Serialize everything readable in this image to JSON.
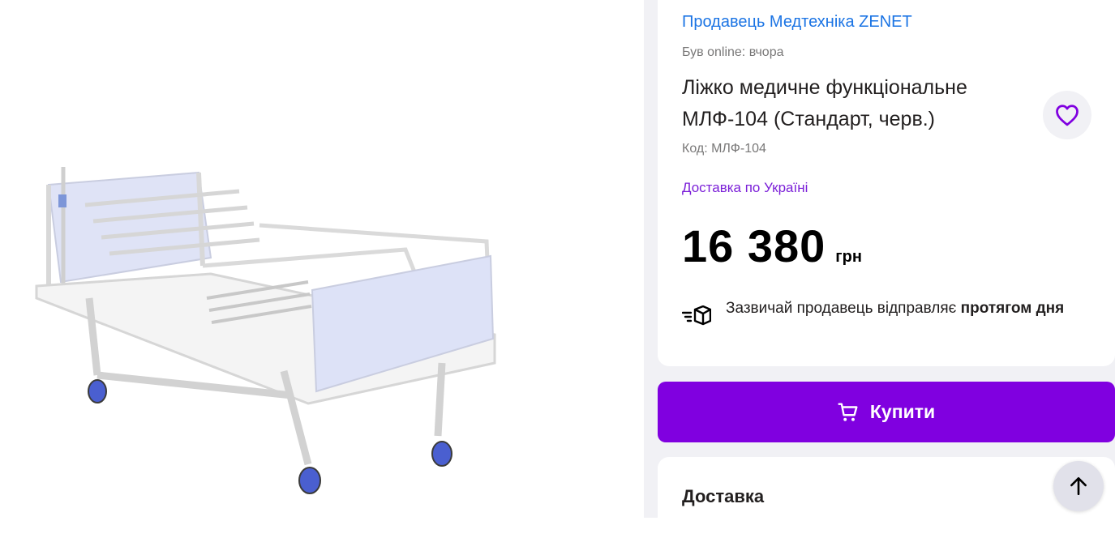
{
  "seller": {
    "link_text": "Продавець Медтехніка ZENET",
    "online_status": "Був online: вчора"
  },
  "product": {
    "title": "Ліжко медичне функціональне МЛФ-104 (Стандарт, черв.)",
    "code": "Код: МЛФ-104",
    "delivery_link": "Доставка по Україні",
    "price": "16 380",
    "currency": "грн",
    "image_icon": "hospital-bed-photo"
  },
  "shipping": {
    "text_regular": "Зазвичай продавець відправляє ",
    "text_bold": "протягом дня",
    "icon": "box-fast-icon"
  },
  "buy_button": {
    "label": "Купити",
    "icon": "cart-icon"
  },
  "delivery_section": {
    "title": "Доставка"
  },
  "favorite_icon": "heart-icon",
  "scroll_top_icon": "arrow-up-icon",
  "colors": {
    "accent": "#8000e0",
    "seller_link": "#1b74e4",
    "delivery_link": "#7b1fd8",
    "side_bg": "#f1f1f5"
  }
}
